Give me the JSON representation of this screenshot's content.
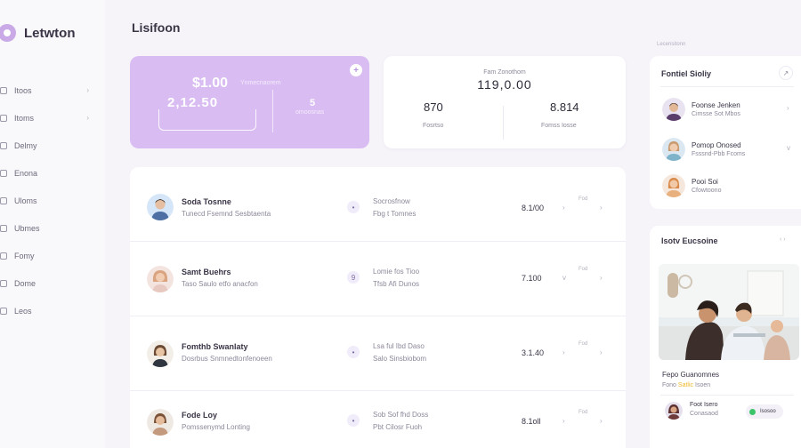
{
  "brand": {
    "name": "Letwton"
  },
  "nav": {
    "items": [
      {
        "label": "Itoos",
        "chevron": "›"
      },
      {
        "label": "Itoms",
        "chevron": "›"
      },
      {
        "label": "Delmy"
      },
      {
        "label": "Enona"
      },
      {
        "label": "Uloms"
      },
      {
        "label": "Ubmes"
      },
      {
        "label": "Fomy"
      },
      {
        "label": "Dome"
      },
      {
        "label": "Leos"
      }
    ]
  },
  "main": {
    "title": "Lisifoon"
  },
  "hero": {
    "amount": "$1.00",
    "note": "Ynmecnaorem",
    "sub_amount": "2,12.50",
    "right_value": "5",
    "right_label": "omoosnas",
    "plus_icon": "+"
  },
  "stats": {
    "label": "Fam Zonothom",
    "total": "119,0.00",
    "left_value": "870",
    "left_label": "Fosrtso",
    "right_value": "8.814",
    "right_label": "Fomss Iosse"
  },
  "rows": [
    {
      "name": "Soda Tosnne",
      "sub": "Tunecd Fsemnd Sesbtaenta",
      "icon": "•",
      "detail1": "Socrosfnow",
      "detail2": "Fbg t Tomnes",
      "amount": "8.1/00",
      "chevron": "›",
      "tag": "Fod",
      "more": "›"
    },
    {
      "name": "Samt Buehrs",
      "sub": "Taso Saulo etfo anacfon",
      "icon": "9",
      "detail1": "Lomie fos Tioo",
      "detail2": "Tfsb Afi Dunos",
      "amount": "7.100",
      "chevron": "v",
      "tag": "Fod",
      "more": "›"
    },
    {
      "name": "Fomthb Swanlaty",
      "sub": "Dosrbus Snmnedtonfenoeen",
      "icon": "•",
      "detail1": "Lsa ful Ibd Daso",
      "detail2": "Salo Sinsbiobom",
      "amount": "3.1.40",
      "chevron": "›",
      "tag": "Fod",
      "more": "›"
    },
    {
      "name": "Fode Loy",
      "sub": "Pomssenymd Lonting",
      "icon": "•",
      "detail1": "Sob Sof fhd Doss",
      "detail2": "Pbt Cilosr Fuoh",
      "amount": "8.1oll",
      "chevron": "›",
      "tag": "Fod",
      "more": "›"
    }
  ],
  "panel1": {
    "hint": "Lecensitonn",
    "title": "Fontiel Sioliy",
    "btn": "↗",
    "people": [
      {
        "name": "Foonse Jenken",
        "role": "Cimsse Sot Mbos",
        "chevron": "›"
      },
      {
        "name": "Pomop Onosed",
        "role": "Fsssnd-Pbb Fcoms",
        "chevron": "v"
      },
      {
        "name": "Pooi Soi",
        "role": "Cfowtoono"
      }
    ]
  },
  "panel2": {
    "title": "Isotv Eucsoine",
    "icons": "‹ ›",
    "cap1": "Fepo Guanomnes",
    "cap2_pre": "Fono",
    "cap2_hl": "Satlic",
    "cap2_post": "Isoen",
    "person_name": "Foot Isero",
    "person_role": "Conasaod",
    "badge": "Isosoo"
  }
}
